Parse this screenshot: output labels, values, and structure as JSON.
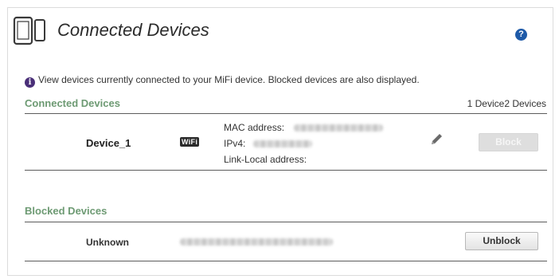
{
  "page": {
    "title": "Connected Devices",
    "help_glyph": "?",
    "info_glyph": "i",
    "info_text": "View devices currently connected to your MiFi device. Blocked devices are also displayed."
  },
  "connected": {
    "section_title": "Connected Devices",
    "count_text": "1 Device2 Devices",
    "devices": [
      {
        "name": "Device_1",
        "connection_badge": "WiFi",
        "mac_label": "MAC address:",
        "ipv4_label": "IPv4:",
        "link_local_label": "Link-Local address:",
        "action_label": "Block"
      }
    ]
  },
  "blocked": {
    "section_title": "Blocked Devices",
    "devices": [
      {
        "name": "Unknown",
        "action_label": "Unblock"
      }
    ]
  },
  "colors": {
    "section_title": "#6d9a73",
    "help_icon": "#1e5aa8",
    "info_icon": "#4a2f78"
  },
  "icons": {
    "header": "tablet-phone-icon",
    "help": "help-icon",
    "info": "info-icon",
    "edit": "pencil-icon"
  }
}
